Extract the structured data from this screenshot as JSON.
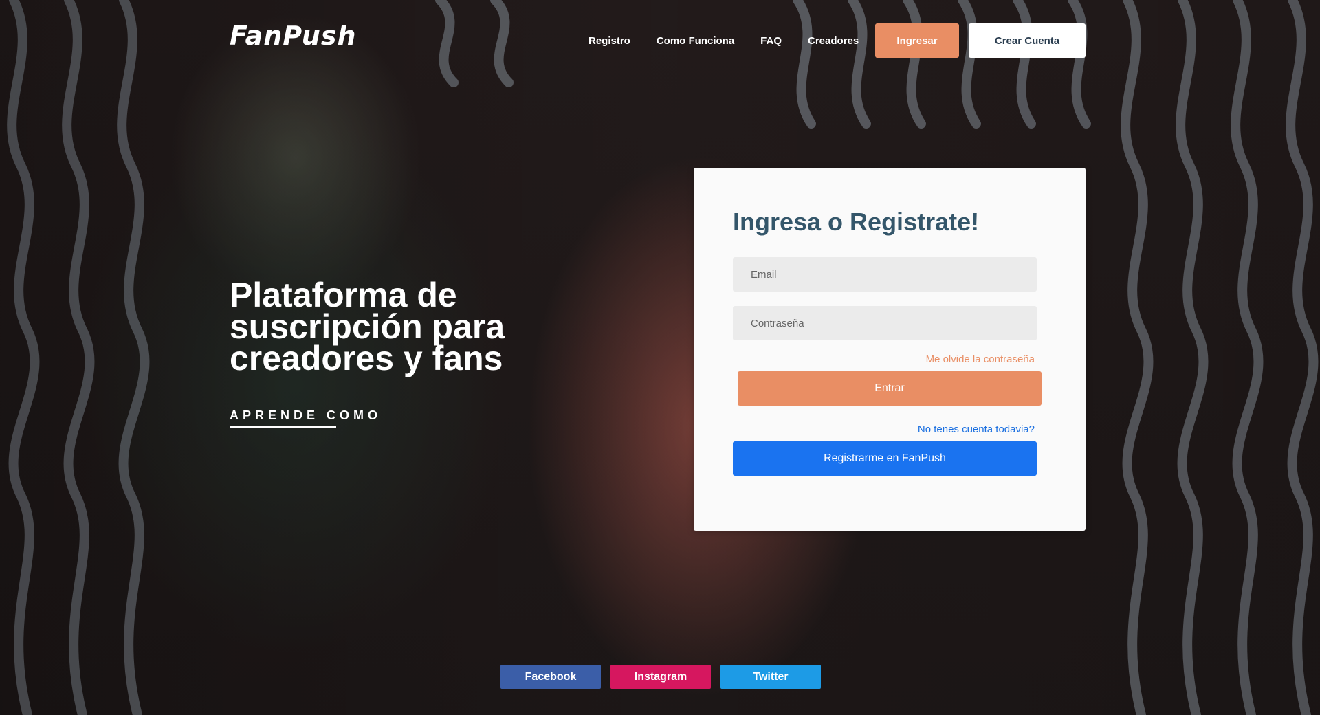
{
  "brand": {
    "logo_text": "FanPush"
  },
  "nav": {
    "links": [
      "Registro",
      "Como Funciona",
      "FAQ",
      "Creadores"
    ],
    "login_button": "Ingresar",
    "signup_button": "Crear Cuenta"
  },
  "hero": {
    "title": "Plataforma de suscripción para creadores y fans",
    "learn_link": "APRENDE COMO"
  },
  "login_card": {
    "title": "Ingresa o Registrate!",
    "email_placeholder": "Email",
    "password_placeholder": "Contraseña",
    "forgot_link": "Me olvide la contraseña",
    "submit_button": "Entrar",
    "no_account_text": "No tenes cuenta todavia?",
    "register_button": "Registrarme en FanPush"
  },
  "social": {
    "facebook": {
      "label": "Facebook",
      "color": "#3b5ea8"
    },
    "instagram": {
      "label": "Instagram",
      "color": "#d6175f"
    },
    "twitter": {
      "label": "Twitter",
      "color": "#1d9be6"
    }
  },
  "colors": {
    "accent": "#e98e64",
    "primary_blue": "#1a73f0",
    "card_title": "#34566a"
  }
}
